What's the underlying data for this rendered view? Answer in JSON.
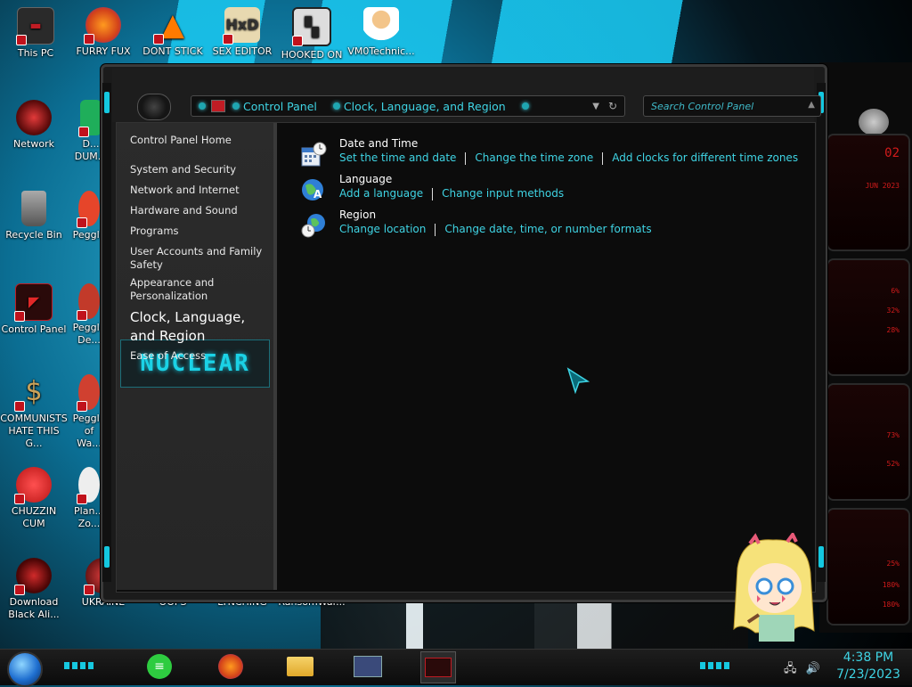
{
  "desktop": {
    "icons": [
      {
        "label": "This PC"
      },
      {
        "label": "FURRY FUX"
      },
      {
        "label": "DONT STICK"
      },
      {
        "label": "SEX EDITOR"
      },
      {
        "label": "HOOKED ON"
      },
      {
        "label": "VM0Technic..."
      },
      {
        "label": "Network"
      },
      {
        "label": "Recycle Bin"
      },
      {
        "label": "Control Panel"
      },
      {
        "label": "COMMUNISTS HATE THIS G..."
      },
      {
        "label": "CHUZZIN CUM"
      },
      {
        "label": "Download Black Ali..."
      },
      {
        "label": "UKRAINE"
      },
      {
        "label": "OOPS"
      },
      {
        "label": "LYNCHING"
      },
      {
        "label": "RansomWar..."
      },
      {
        "label": "D... DUM..."
      },
      {
        "label": "Peggle"
      },
      {
        "label": "Peggle De..."
      },
      {
        "label": "Peggle of Wa..."
      },
      {
        "label": "Plan... Zo..."
      }
    ],
    "widget_numbers": [
      "02",
      "JUN 2023",
      "6%",
      "32%",
      "28%",
      "73%",
      "52%",
      "25%",
      "180%",
      "180%"
    ]
  },
  "window": {
    "address": {
      "crumbs": [
        "Control Panel",
        "Clock, Language, and Region"
      ]
    },
    "search": {
      "placeholder": "Search Control Panel"
    },
    "sidebar": {
      "home": "Control Panel Home",
      "items": [
        "System and Security",
        "Network and Internet",
        "Hardware and Sound",
        "Programs",
        "User Accounts and Family Safety",
        "Appearance and Personalization",
        "Clock, Language, and Region",
        "Ease of Access"
      ],
      "logo_text": "NUCLEAR"
    },
    "categories": [
      {
        "title": "Date and Time",
        "icon": "calendar-clock-icon",
        "links": [
          "Set the time and date",
          "Change the time zone",
          "Add clocks for different time zones"
        ]
      },
      {
        "title": "Language",
        "icon": "globe-language-icon",
        "links": [
          "Add a language",
          "Change input methods"
        ]
      },
      {
        "title": "Region",
        "icon": "globe-clock-icon",
        "links": [
          "Change location",
          "Change date, time, or number formats"
        ]
      }
    ]
  },
  "taskbar": {
    "clock": {
      "time": "4:38 PM",
      "date": "7/23/2023"
    },
    "apps": [
      "notes-app-icon",
      "firefox-icon",
      "file-explorer-icon",
      "control-panel-icon",
      "alienware-icon"
    ]
  },
  "colors": {
    "accent": "#3fd4e4",
    "alert": "#c0121c"
  }
}
